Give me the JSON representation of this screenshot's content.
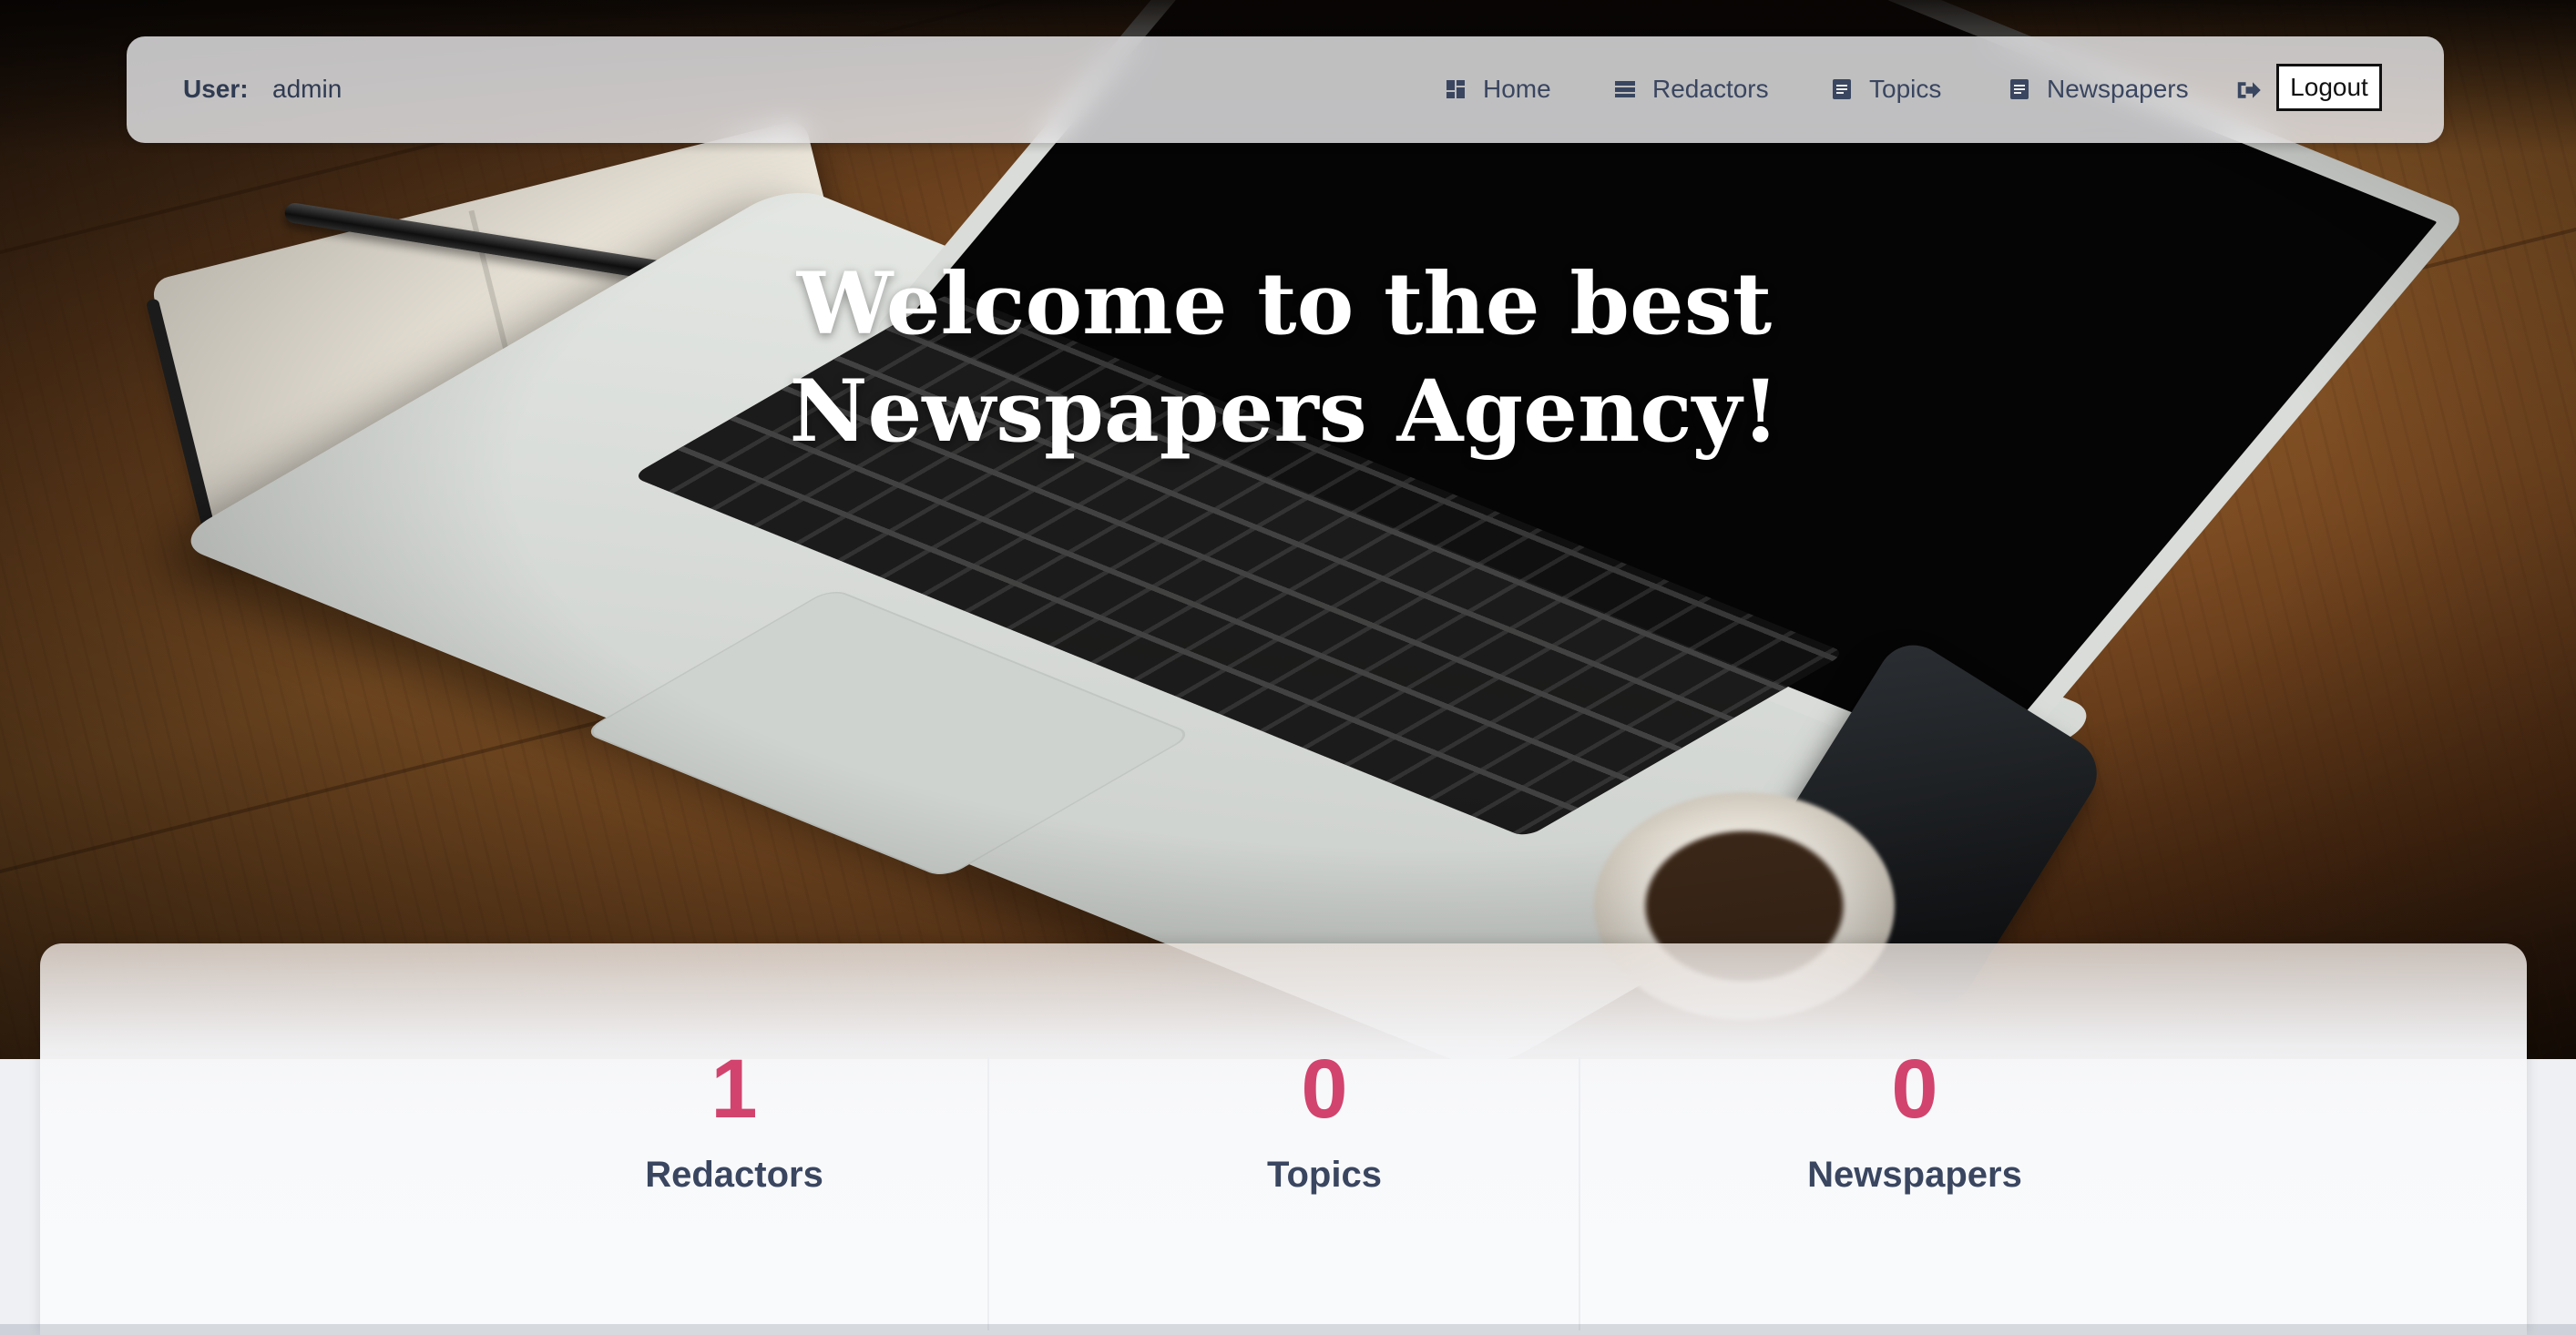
{
  "navbar": {
    "user_label": "User:",
    "user_name": "admin",
    "items": [
      {
        "label": "Home",
        "icon": "dashboard-icon"
      },
      {
        "label": "Redactors",
        "icon": "list-icon"
      },
      {
        "label": "Topics",
        "icon": "document-icon"
      },
      {
        "label": "Newspapers",
        "icon": "document-icon"
      }
    ],
    "logout_label": "Logout",
    "logout_icon": "logout-icon"
  },
  "hero": {
    "title_line1": "Welcome to the best",
    "title_line2": "Newspapers Agency!"
  },
  "stats": [
    {
      "value": "1",
      "label": "Redactors"
    },
    {
      "value": "0",
      "label": "Topics"
    },
    {
      "value": "0",
      "label": "Newspapers"
    }
  ],
  "colors": {
    "accent": "#d2436e",
    "text_primary": "#3a4660",
    "navbar_bg": "#eeeef0"
  }
}
